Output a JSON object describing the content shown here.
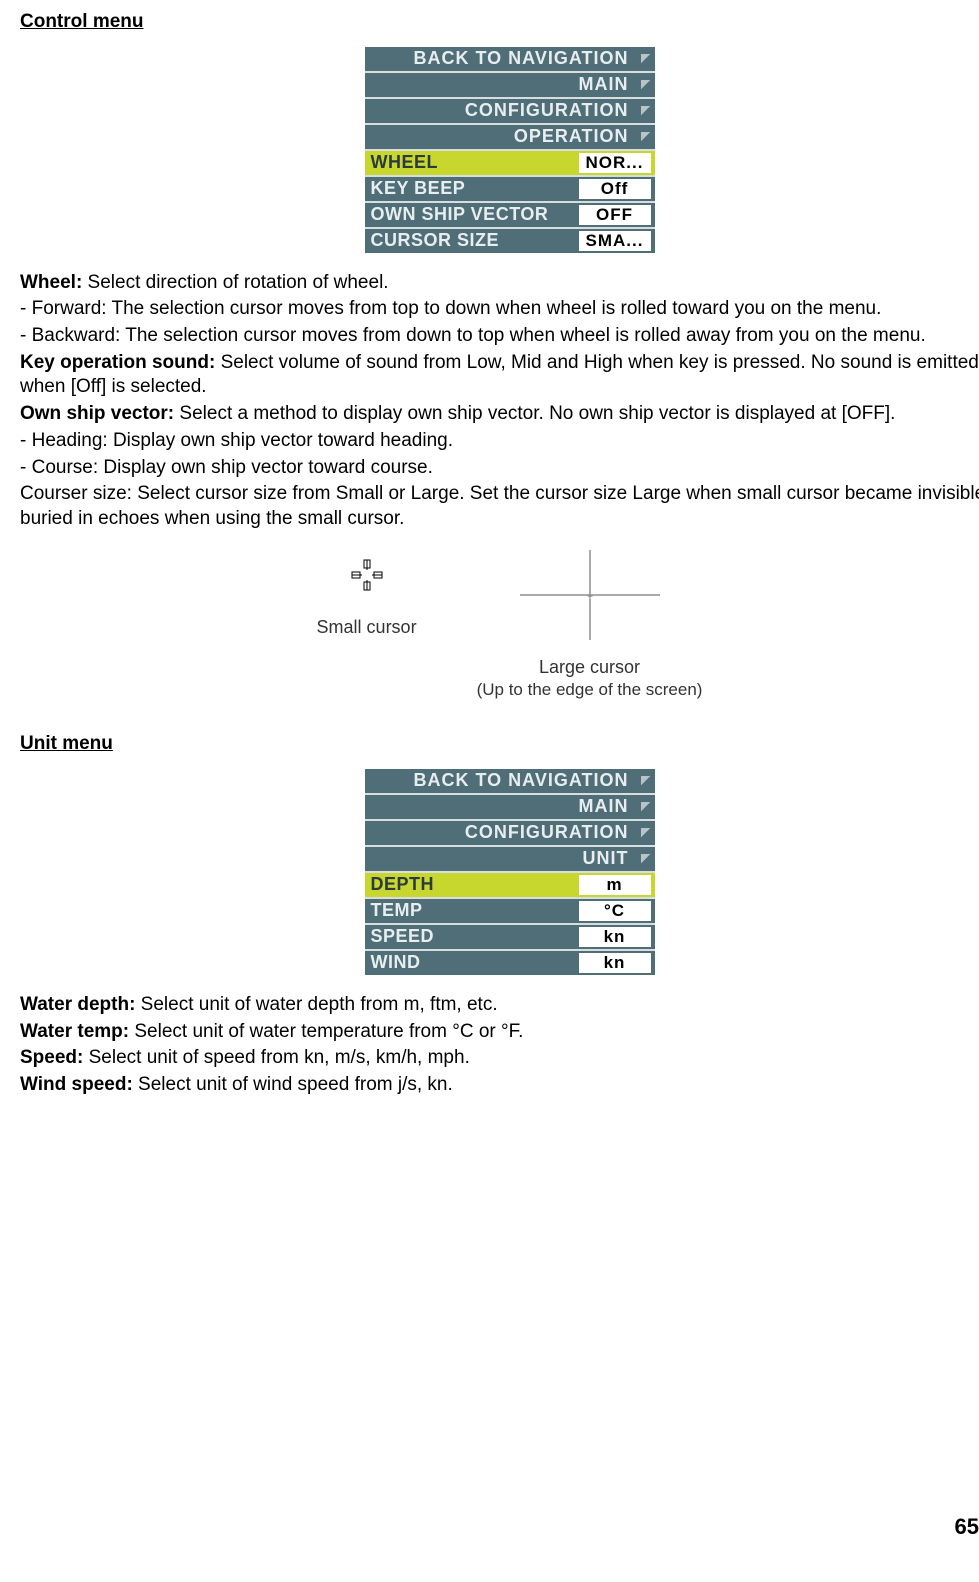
{
  "section1": {
    "title": "Control menu",
    "menu": {
      "nav": [
        "BACK TO NAVIGATION",
        "MAIN",
        "CONFIGURATION",
        "OPERATION"
      ],
      "rows": [
        {
          "label": "WHEEL",
          "value": "NOR...",
          "selected": true
        },
        {
          "label": "KEY BEEP",
          "value": "Off",
          "selected": false
        },
        {
          "label": "OWN SHIP VECTOR",
          "value": "OFF",
          "selected": false
        },
        {
          "label": "CURSOR SIZE",
          "value": "SMA...",
          "selected": false
        }
      ]
    },
    "body": {
      "wheel_label": "Wheel:",
      "wheel_text": " Select direction of rotation of wheel.",
      "wheel_fwd": "- Forward: The selection cursor moves from top to down when wheel is rolled toward you on the menu.",
      "wheel_bwd": "- Backward: The selection cursor moves from down to top when wheel is rolled away from you on the menu.",
      "keybeep_label": "Key operation sound:",
      "keybeep_text": " Select volume of sound from Low, Mid and High when key is pressed. No sound is emitted when [Off] is selected.",
      "osv_label": "Own ship vector:",
      "osv_text": " Select a method to display own ship vector. No own ship vector is displayed at [OFF].",
      "osv_heading": "- Heading: Display own ship vector toward heading.",
      "osv_course": "- Course: Display own ship vector toward course.",
      "courser": "Courser size: Select cursor size from Small or Large. Set the cursor size Large when small cursor became invisible buried in echoes when using the small cursor."
    },
    "cursor_fig": {
      "small": "Small cursor",
      "large": "Large cursor",
      "large_sub": "(Up to the edge of the screen)"
    }
  },
  "section2": {
    "title": "Unit menu",
    "menu": {
      "nav": [
        "BACK TO NAVIGATION",
        "MAIN",
        "CONFIGURATION",
        "UNIT"
      ],
      "rows": [
        {
          "label": "DEPTH",
          "value": "m",
          "selected": true
        },
        {
          "label": "TEMP",
          "value": "°C",
          "selected": false
        },
        {
          "label": "SPEED",
          "value": "kn",
          "selected": false
        },
        {
          "label": "WIND",
          "value": "kn",
          "selected": false
        }
      ]
    },
    "body": {
      "depth_label": "Water depth:",
      "depth_text": " Select unit of water depth from m, ftm, etc.",
      "temp_label": "Water temp:",
      "temp_text": " Select unit of water temperature from °C or °F.",
      "speed_label": "Speed:",
      "speed_text": " Select unit of speed from kn, m/s, km/h, mph.",
      "wind_label": "Wind speed:",
      "wind_text": " Select unit of wind speed from j/s, kn."
    }
  },
  "page_number": "65"
}
